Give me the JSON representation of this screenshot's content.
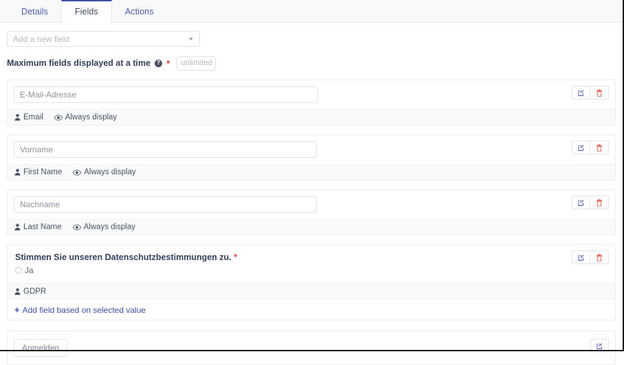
{
  "tabs": [
    {
      "label": "Details",
      "active": false
    },
    {
      "label": "Fields",
      "active": true
    },
    {
      "label": "Actions",
      "active": false
    }
  ],
  "toolbar": {
    "add_field_placeholder": "Add a new field",
    "dropdown_icon": "chevron-down-icon"
  },
  "max_fields": {
    "label": "Maximum fields displayed at a time",
    "help_icon": "question-circle-icon",
    "required_marker": "*",
    "input_placeholder": "unlimited",
    "input_value": ""
  },
  "fields": [
    {
      "input_placeholder": "E-Mail-Adresse",
      "type_label": "Email",
      "type_icon": "user-icon",
      "visibility_label": "Always display",
      "visibility_icon": "eye-icon",
      "edit_icon": "edit-square-icon",
      "delete_icon": "trash-icon"
    },
    {
      "input_placeholder": "Vorname",
      "type_label": "First Name",
      "type_icon": "user-icon",
      "visibility_label": "Always display",
      "visibility_icon": "eye-icon",
      "edit_icon": "edit-square-icon",
      "delete_icon": "trash-icon"
    },
    {
      "input_placeholder": "Nachname",
      "type_label": "Last Name",
      "type_icon": "user-icon",
      "visibility_label": "Always display",
      "visibility_icon": "eye-icon",
      "edit_icon": "edit-square-icon",
      "delete_icon": "trash-icon"
    }
  ],
  "gdpr": {
    "title": "Stimmen Sie unseren Datenschutzbestimmungen zu.",
    "required_marker": "*",
    "radio_label": "Ja",
    "radio_checked": false,
    "type_label": "GDPR",
    "type_icon": "user-icon",
    "add_conditional_label": "Add field based on selected value",
    "add_conditional_icon": "plus-icon",
    "edit_icon": "edit-square-icon",
    "delete_icon": "trash-icon"
  },
  "submit": {
    "button_label": "Anmelden",
    "edit_icon": "edit-square-icon"
  },
  "colors": {
    "accent": "#3d4ea3",
    "link": "#3f51a5",
    "danger": "#e04b3c",
    "meta_bg": "#f9fafb",
    "tabbar_bg": "#f8f9fa",
    "border": "#e6e8ec"
  }
}
